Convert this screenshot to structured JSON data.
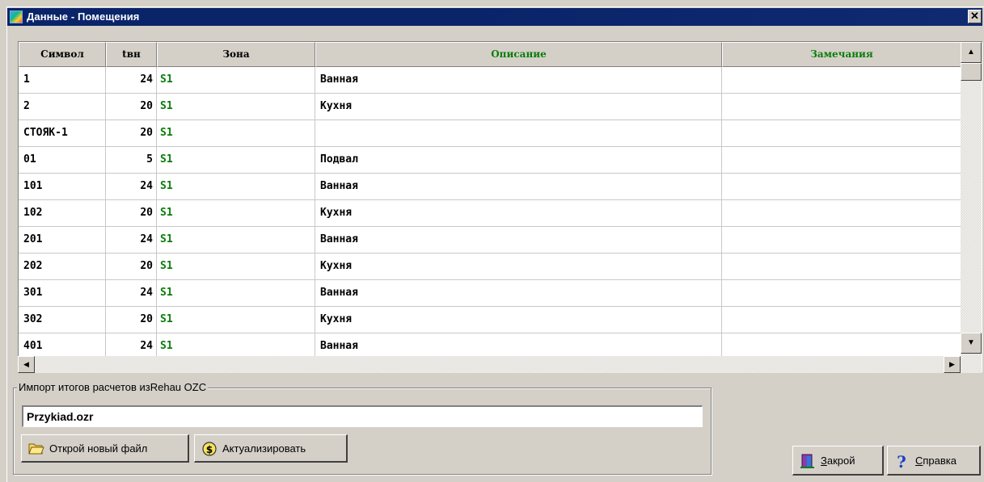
{
  "window": {
    "title": "Данные - Помещения",
    "close_glyph": "✕"
  },
  "table": {
    "headers": [
      "Символ",
      "tвн",
      "Зона",
      "Описание",
      "Замечания"
    ],
    "header_colors": [
      "#000000",
      "#000000",
      "#000000",
      "#0a7d0a",
      "#0a7d0a"
    ],
    "rows": [
      {
        "symbol": "1",
        "t": "24",
        "zone": "S1",
        "desc": "Ванная",
        "notes": ""
      },
      {
        "symbol": "2",
        "t": "20",
        "zone": "S1",
        "desc": "Кухня",
        "notes": ""
      },
      {
        "symbol": "СТОЯК-1",
        "t": "20",
        "zone": "S1",
        "desc": "",
        "notes": ""
      },
      {
        "symbol": "01",
        "t": "5",
        "zone": "S1",
        "desc": "Подвал",
        "notes": ""
      },
      {
        "symbol": "101",
        "t": "24",
        "zone": "S1",
        "desc": "Ванная",
        "notes": ""
      },
      {
        "symbol": "102",
        "t": "20",
        "zone": "S1",
        "desc": "Кухня",
        "notes": ""
      },
      {
        "symbol": "201",
        "t": "24",
        "zone": "S1",
        "desc": "Ванная",
        "notes": ""
      },
      {
        "symbol": "202",
        "t": "20",
        "zone": "S1",
        "desc": "Кухня",
        "notes": ""
      },
      {
        "symbol": "301",
        "t": "24",
        "zone": "S1",
        "desc": "Ванная",
        "notes": ""
      },
      {
        "symbol": "302",
        "t": "20",
        "zone": "S1",
        "desc": "Кухня",
        "notes": ""
      },
      {
        "symbol": "401",
        "t": "24",
        "zone": "S1",
        "desc": "Ванная",
        "notes": ""
      }
    ]
  },
  "import_group": {
    "label": "Импорт итогов расчетов изRehau OZC",
    "file_value": "Przykiad.ozr",
    "open_button": "Открой новый файл",
    "update_button": "Актуализировать"
  },
  "footer": {
    "close_button_hotkey": "З",
    "close_button_rest": "акрой",
    "help_button_hotkey": "С",
    "help_button_rest": "правка"
  },
  "colors": {
    "title_bar": "#0a246a",
    "face": "#d4d0c8",
    "zone_text": "#0a7d0a"
  }
}
